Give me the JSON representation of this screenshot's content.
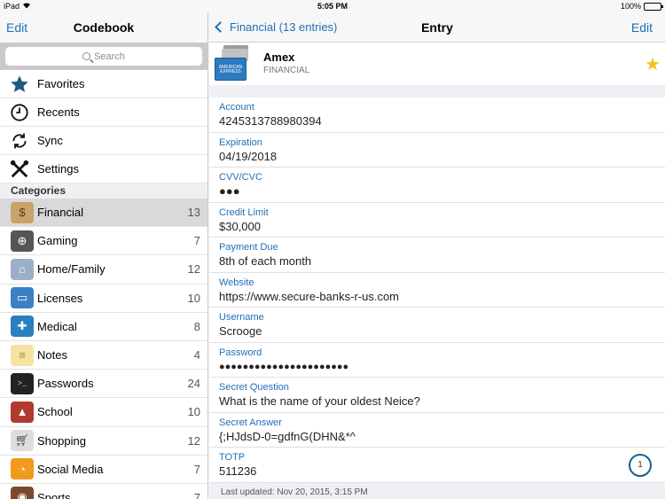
{
  "status": {
    "device": "iPad",
    "time": "5:05 PM",
    "battery": "100%"
  },
  "sidebar": {
    "edit_label": "Edit",
    "title": "Codebook",
    "search_placeholder": "Search",
    "menu": [
      {
        "label": "Favorites",
        "icon": "star-icon"
      },
      {
        "label": "Recents",
        "icon": "clock-icon"
      },
      {
        "label": "Sync",
        "icon": "sync-icon"
      },
      {
        "label": "Settings",
        "icon": "tools-icon"
      }
    ],
    "categories_header": "Categories",
    "categories": [
      {
        "label": "Financial",
        "count": "13",
        "icon": "money-bag-icon",
        "color": "#b08a4e"
      },
      {
        "label": "Gaming",
        "count": "7",
        "icon": "gamepad-icon",
        "color": "#555555"
      },
      {
        "label": "Home/Family",
        "count": "12",
        "icon": "house-icon",
        "color": "#7a8fa5"
      },
      {
        "label": "Licenses",
        "count": "10",
        "icon": "laptop-icon",
        "color": "#3b7fc4"
      },
      {
        "label": "Medical",
        "count": "8",
        "icon": "medical-icon",
        "color": "#2a7fc0"
      },
      {
        "label": "Notes",
        "count": "4",
        "icon": "notepad-icon",
        "color": "#f4e3a3"
      },
      {
        "label": "Passwords",
        "count": "24",
        "icon": "terminal-icon",
        "color": "#222222"
      },
      {
        "label": "School",
        "count": "10",
        "icon": "school-icon",
        "color": "#b03a2e"
      },
      {
        "label": "Shopping",
        "count": "12",
        "icon": "cart-icon",
        "color": "#888888"
      },
      {
        "label": "Social Media",
        "count": "7",
        "icon": "chat-icon",
        "color": "#f29a1d"
      },
      {
        "label": "Sports",
        "count": "7",
        "icon": "football-icon",
        "color": "#7b4a2b"
      }
    ]
  },
  "detail": {
    "back_label": "Financial (13 entries)",
    "title": "Entry",
    "edit_label": "Edit",
    "entry_name": "Amex",
    "entry_category": "FINANCIAL",
    "card_text": "AMERICAN EXPRESS",
    "fields": [
      {
        "label": "Account",
        "value": "4245313788980394"
      },
      {
        "label": "Expiration",
        "value": "04/19/2018"
      },
      {
        "label": "CVV/CVC",
        "value": "●●●"
      },
      {
        "label": "Credit Limit",
        "value": "$30,000"
      },
      {
        "label": "Payment Due",
        "value": "8th of each month"
      },
      {
        "label": "Website",
        "value": "https://www.secure-banks-r-us.com"
      },
      {
        "label": "Username",
        "value": "Scrooge"
      },
      {
        "label": "Password",
        "value": "●●●●●●●●●●●●●●●●●●●●●●"
      },
      {
        "label": "Secret Question",
        "value": "What is the name of your oldest Neice?"
      },
      {
        "label": "Secret Answer",
        "value": "{;HJdsD-0=gdfnG(DHN&*^"
      },
      {
        "label": "TOTP",
        "value": "511236"
      }
    ],
    "totp_countdown": "1",
    "last_updated": "Last updated: Nov 20, 2015, 3:15 PM"
  }
}
